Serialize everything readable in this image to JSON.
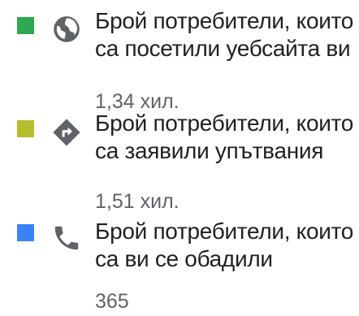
{
  "legend": {
    "items": [
      {
        "label": "Брой потребители, които са посетили уебсайта ви",
        "value": "1,34 хил.",
        "color": "#2fa84f",
        "icon": "globe-icon"
      },
      {
        "label": "Брой потребители, които са заявили упътвания",
        "value": "1,51 хил.",
        "color": "#b5bd2c",
        "icon": "directions-icon"
      },
      {
        "label": "Брой потребители, които са ви се обадили",
        "value": "365",
        "color": "#3b82f6",
        "icon": "phone-icon"
      }
    ]
  }
}
